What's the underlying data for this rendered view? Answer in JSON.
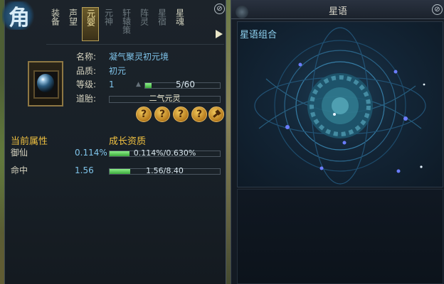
{
  "left_panel": {
    "emblem_char": "角",
    "tabs": [
      {
        "label": "装备",
        "state": "normal"
      },
      {
        "label": "声望",
        "state": "normal"
      },
      {
        "label": "元婴",
        "state": "active"
      },
      {
        "label": "元神",
        "state": "dim"
      },
      {
        "label": "轩辕策",
        "state": "dim"
      },
      {
        "label": "阵灵",
        "state": "dim"
      },
      {
        "label": "星宿",
        "state": "dim"
      },
      {
        "label": "星魂",
        "state": "normal"
      }
    ],
    "close_glyph": "⊘",
    "item": {
      "name_label": "名称:",
      "name_value": "凝气聚灵初元境",
      "quality_label": "品质:",
      "quality_value": "初元",
      "level_label": "等级:",
      "level_value": "1",
      "level_progress_text": "5/60",
      "level_progress": 0.0833,
      "embryo_label": "道胎:",
      "embryo_value": "二气元灵",
      "question_glyph": "?",
      "question_count": 4
    },
    "attributes": {
      "current_header": "当前属性",
      "growth_header": "成长资质",
      "rows": [
        {
          "name": "御仙",
          "value": "0.114%",
          "bar_text": "0.114%/0.630%",
          "progress": 0.181
        },
        {
          "name": "命中",
          "value": "1.56",
          "bar_text": "1.56/8.40",
          "progress": 0.186
        }
      ]
    }
  },
  "right_panel": {
    "title": "星语",
    "close_glyph": "⊘",
    "section_title": "星语组合"
  },
  "colors": {
    "accent_gold": "#f0c040",
    "value_blue": "#7fc4ea",
    "bar_green": "#3aa83a"
  }
}
